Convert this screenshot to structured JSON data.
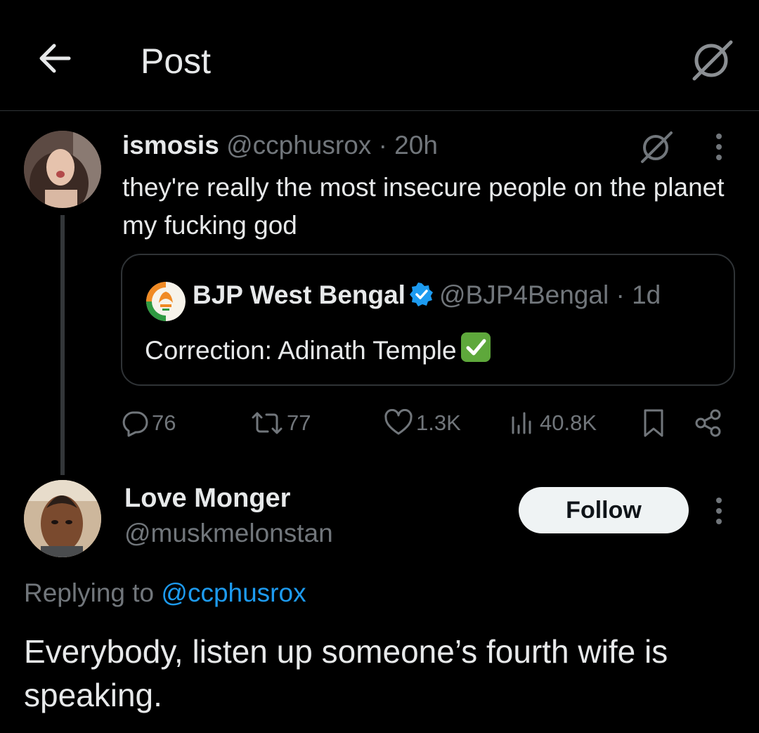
{
  "header": {
    "title": "Post",
    "back_icon": "arrow-left-icon",
    "grok_icon": "grok-icon"
  },
  "tweet": {
    "author_name": "ismosis",
    "handle": "@ccphusrox",
    "separator": "·",
    "time": "20h",
    "text": "they're really the most insecure people on the planet my fucking god",
    "quote": {
      "author_name": "BJP West Bengal",
      "verified": true,
      "handle": "@BJP4Bengal",
      "separator": "·",
      "time": "1d",
      "text": "Correction: Adinath Temple"
    },
    "stats": {
      "replies": "76",
      "reposts": "77",
      "likes": "1.3K",
      "views": "40.8K"
    }
  },
  "reply": {
    "author_name": "Love Monger",
    "handle": "@muskmelonstan",
    "follow_label": "Follow",
    "replying_prefix": "Replying to",
    "replying_handle": "@ccphusrox",
    "text": "Everybody, listen up someone’s fourth wife is speaking."
  },
  "colors": {
    "background": "#000000",
    "text": "#e7e9ea",
    "muted": "#71767b",
    "link": "#1d9bf0",
    "border": "#2f3336",
    "verified": "#1d9bf0"
  }
}
